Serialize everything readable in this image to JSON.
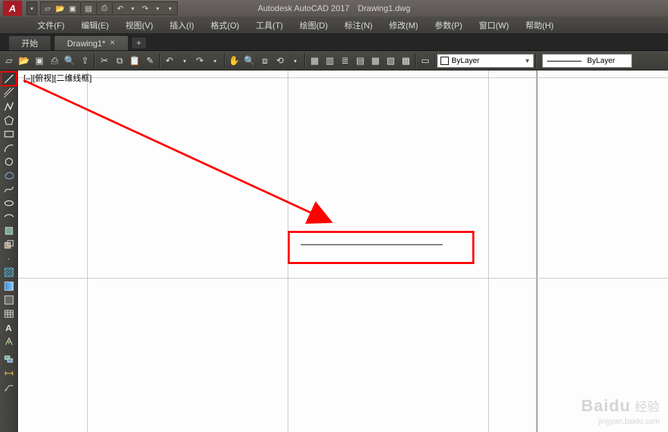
{
  "title": {
    "app": "Autodesk AutoCAD 2017",
    "doc": "Drawing1.dwg"
  },
  "menubar": [
    "文件(F)",
    "编辑(E)",
    "视图(V)",
    "插入(I)",
    "格式(O)",
    "工具(T)",
    "绘图(D)",
    "标注(N)",
    "修改(M)",
    "参数(P)",
    "窗口(W)",
    "帮助(H)"
  ],
  "tabs": {
    "start": "开始",
    "doc": "Drawing1*",
    "add": "+"
  },
  "qat_icons": [
    "new",
    "open",
    "save",
    "saveall",
    "plot",
    "undo",
    "redo"
  ],
  "toolbar_icons": [
    "new",
    "open",
    "save",
    "cut",
    "copy",
    "paste",
    "match",
    "undo",
    "redo",
    "pan",
    "zoom-ext",
    "zoom-win",
    "zoom",
    "prop",
    "sheet",
    "layer",
    "tool",
    "block",
    "design",
    "cloud"
  ],
  "layer_dd": "ByLayer",
  "linetype_dd": "ByLayer",
  "canvas_label": "[–][俯视][二维线框]",
  "watermark": {
    "brand": "Baidu",
    "cn": "经验",
    "url": "jingyan.baidu.com"
  },
  "left_tools": [
    "line",
    "pline",
    "circle",
    "arc",
    "rect",
    "polygon",
    "ellipse",
    "hatch",
    "spline",
    "point",
    "cloud",
    "region",
    "gradient",
    "table",
    "bound",
    "rectext",
    "rectfill",
    "grid",
    "text",
    "mtext",
    "dim",
    "leader",
    "brush",
    "wipe"
  ]
}
